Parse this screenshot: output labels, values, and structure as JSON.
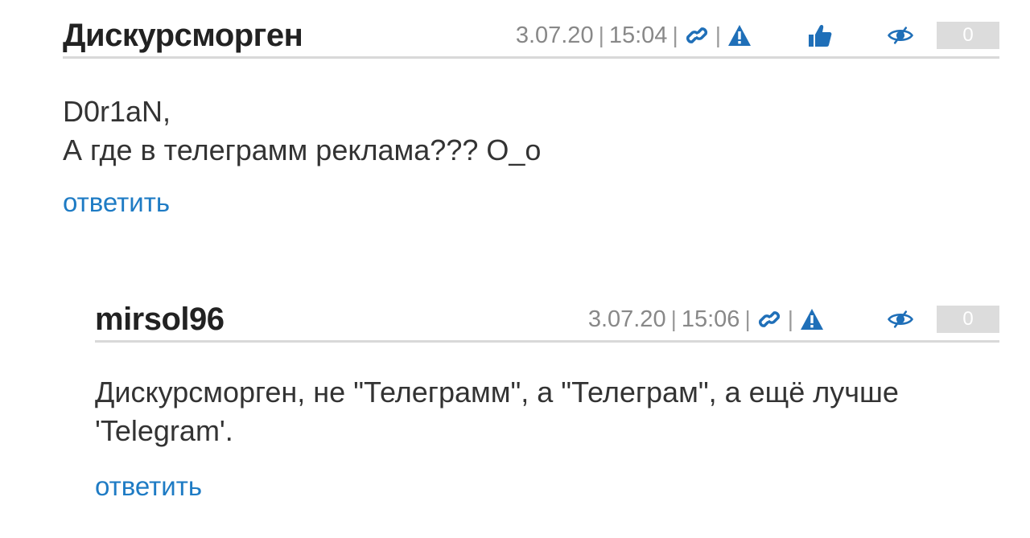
{
  "comments": [
    {
      "author": "Дискурсморген",
      "date": "3.07.20",
      "time": "15:04",
      "lines": [
        "D0r1aN,",
        "А где в телеграмм реклама??? О_о"
      ],
      "reply_label": "ответить",
      "counter": "0",
      "has_like": true
    },
    {
      "author": "mirsol96",
      "date": "3.07.20",
      "time": "15:06",
      "lines": [
        "Дискурсморген, не \"Телеграмм\", а \"Телеграм\", а ещё лучше 'Telegram'."
      ],
      "reply_label": "ответить",
      "counter": "0",
      "has_like": false
    }
  ],
  "separator": "|",
  "icons": [
    "link-icon",
    "warning-icon",
    "thumbs-up-icon",
    "hide-eye-icon"
  ],
  "colors": {
    "icon_blue": "#1f6fb8",
    "reply_link": "#1e7bc4",
    "meta_gray": "#888888",
    "counter_bg": "#dcdcdc",
    "divider": "#d9d9d9"
  }
}
